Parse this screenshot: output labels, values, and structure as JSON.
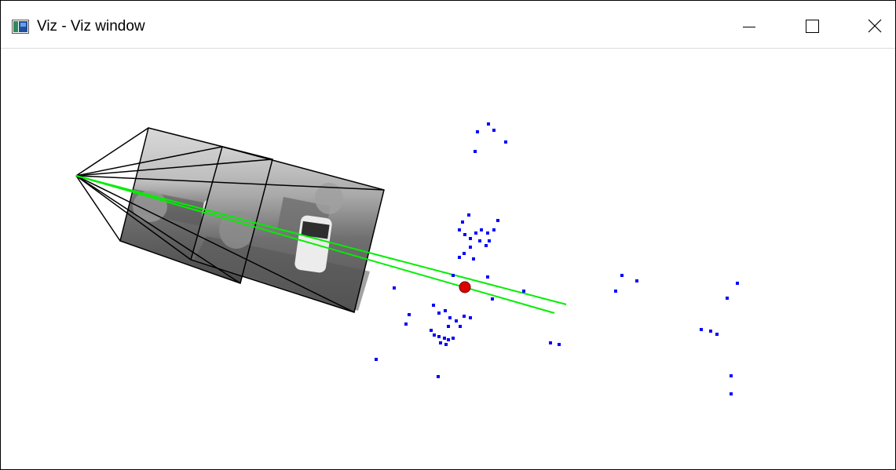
{
  "window": {
    "title": "Viz - Viz window"
  },
  "icons": {
    "app": "viz-app-icon",
    "minimize": "minimize-icon",
    "maximize": "maximize-icon",
    "close": "close-icon"
  },
  "scene": {
    "type": "3d-point-cloud-with-camera-frustums",
    "colors": {
      "points": "#0000ff",
      "rays": "#00ee00",
      "marker": "#dd0000",
      "frustum": "#000000"
    }
  }
}
